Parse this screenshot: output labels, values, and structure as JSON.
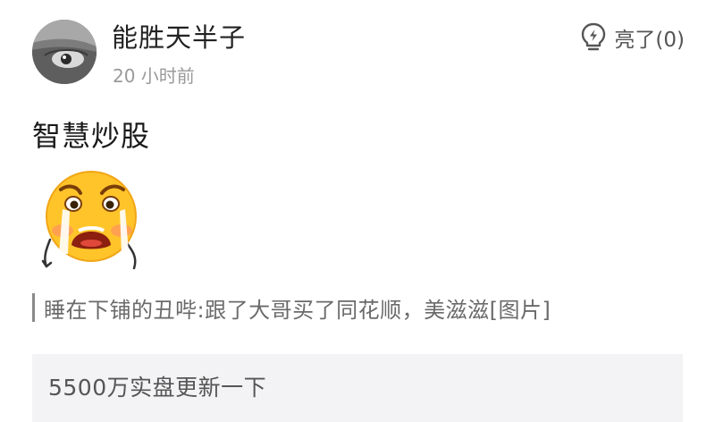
{
  "comment": {
    "username": "能胜天半子",
    "timestamp": "20 小时前",
    "like_label": "亮了(0)",
    "text": "智慧炒股",
    "emoji": "crying-face-emoji",
    "quote": "睡在下铺的丑哔:跟了大哥买了同花顺，美滋滋[图片]"
  },
  "reply_preview": {
    "text": "5500万实盘更新一下"
  },
  "colors": {
    "quote_bar": "#8a8a8a",
    "reply_background": "#f3f3f5",
    "emoji_face": "#ffc42a",
    "timestamp": "#9a9a9a"
  },
  "icons": [
    "lightbulb-icon",
    "crying-face-emoji"
  ]
}
